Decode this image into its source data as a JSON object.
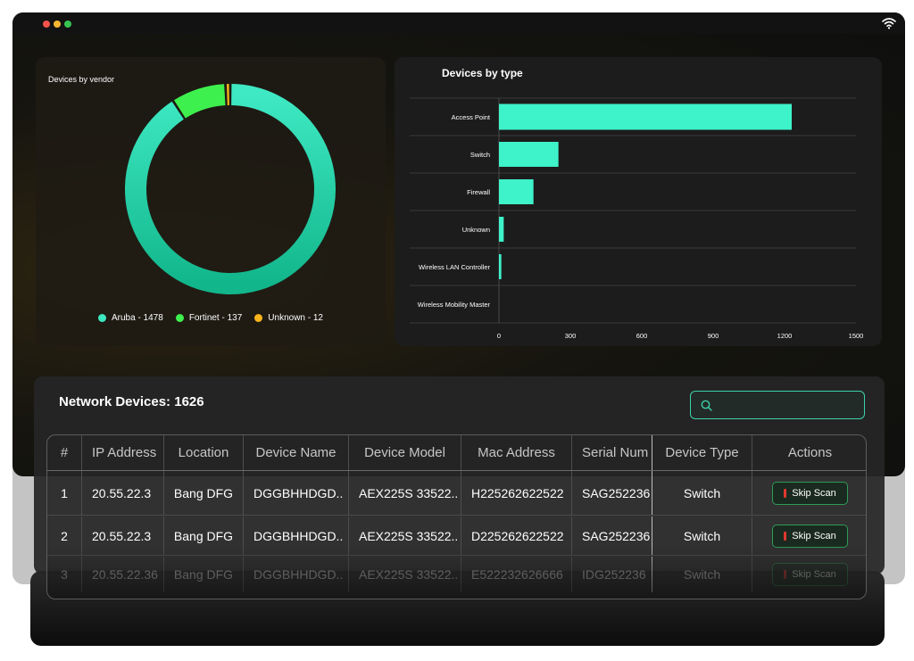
{
  "vendor_chart": {
    "title": "Devices by vendor",
    "legend": [
      {
        "label": "Aruba - 1478",
        "color": "#3de8c0"
      },
      {
        "label": "Fortinet - 137",
        "color": "#3ef04d"
      },
      {
        "label": "Unknown - 12",
        "color": "#f8b51b"
      }
    ]
  },
  "type_chart": {
    "title": "Devices by type"
  },
  "chart_data": [
    {
      "type": "pie",
      "title": "Devices by vendor",
      "categories": [
        "Aruba",
        "Fortinet",
        "Unknown"
      ],
      "values": [
        1478,
        137,
        12
      ],
      "colors": [
        "#3de8c0",
        "#3ef04d",
        "#f8b51b"
      ],
      "legend": "bottom"
    },
    {
      "type": "bar",
      "orientation": "horizontal",
      "title": "Devices by type",
      "categories": [
        "Access Point",
        "Switch",
        "Firewall",
        "Unknown",
        "Wireless LAN Controller",
        "Wireless Mobility Master"
      ],
      "values": [
        1230,
        250,
        145,
        20,
        10,
        0
      ],
      "xlim": [
        0,
        1500
      ],
      "xticks": [
        "0",
        "300",
        "600",
        "900",
        "1200",
        "1500"
      ],
      "bar_color": "#3ef2c9",
      "grid": true
    }
  ],
  "devices": {
    "title": "Network Devices: 1626",
    "search": {
      "value": "",
      "placeholder": ""
    },
    "columns": [
      "#",
      "IP Address",
      "Location",
      "Device Name",
      "Device Model",
      "Mac Address",
      "Serial Num",
      "Device Type",
      "Actions"
    ],
    "rows": [
      {
        "num": "1",
        "ip": "20.55.22.3",
        "location": "Bang DFG",
        "name": "DGGBHHDGD..",
        "model": "AEX225S 33522..",
        "mac": "H225262622522",
        "serial": "SAG252236",
        "type": "Switch",
        "action": "Skip Scan"
      },
      {
        "num": "2",
        "ip": "20.55.22.3",
        "location": "Bang DFG",
        "name": "DGGBHHDGD..",
        "model": "AEX225S 33522..",
        "mac": "D225262622522",
        "serial": "SAG252236",
        "type": "Switch",
        "action": "Skip Scan"
      },
      {
        "num": "3",
        "ip": "20.55.22.36",
        "location": "Bang DFG",
        "name": "DGGBHHDGD..",
        "model": "AEX225S 33522..",
        "mac": "E522232626666",
        "serial": "IDG252236",
        "type": "Switch",
        "action": "Skip Scan"
      }
    ]
  }
}
